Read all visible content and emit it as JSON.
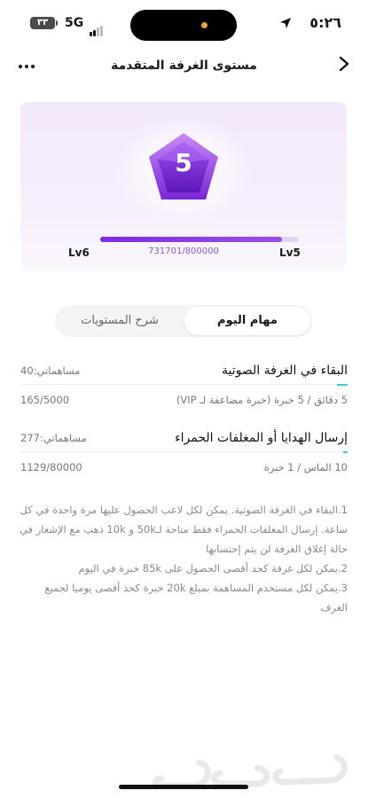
{
  "status_bar": {
    "time": "٥:٢٦",
    "battery": "٣٣",
    "network": "5G"
  },
  "header": {
    "title": "مستوى الغرفة المتقدمة",
    "back_icon": "chevron-right-icon",
    "more_icon": "more-horizontal-icon"
  },
  "level_card": {
    "current_level_number": "5",
    "progress_text": "731701/800000",
    "progress_fraction": 0.9146,
    "current_level_label": "Lv5",
    "next_level_label": "Lv6"
  },
  "tabs": [
    {
      "label": "مهام اليوم",
      "active": true
    },
    {
      "label": "شرح المستويات",
      "active": false
    }
  ],
  "tasks": [
    {
      "title": "البقاء في الغرفة الصوتية",
      "contribution": "مساهماتي:40",
      "reward": "5 دقائق / 5 خبرة (خبرة مضاعفة لـ VIP)",
      "count": "165/5000",
      "progress_fraction": 0.033
    },
    {
      "title": "إرسال الهدايا أو المغلفات الحمراء",
      "contribution": "مساهماتي:277",
      "reward": "10 الماس / 1 خبرة",
      "count": "1129/80000",
      "progress_fraction": 0.014
    }
  ],
  "notes": [
    "1.البقاء في الغرفة الصوتية. يمكن لكل لاعب الحصول عليها مرة واحدة في كل ساعة. إرسال المغلفات الحمراء فقط متاحة لـ50k و 10k ذهب مع الإشعار في حالة إغلاق الغرفة لن يتم إحتسابها",
    "2.يمكن لكل غرفة كحد أقصى الحصول على 85k خبرة في اليوم",
    "3.يمكن لكل مستخدم المساهمة بمبلغ 20k خبرة كحد أقصى يوميا لجميع الغرف"
  ],
  "colors": {
    "accent": "#8a3ee6",
    "progress_cyan": "#39c9e0",
    "card_bg": "#f3e9fb"
  }
}
